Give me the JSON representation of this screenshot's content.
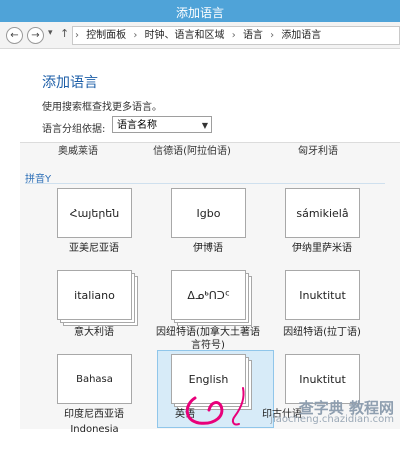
{
  "window": {
    "title": "添加语言"
  },
  "nav": {
    "back": "←",
    "forward": "→",
    "dropdown": "▾",
    "up": "↑"
  },
  "breadcrumb": [
    "控制面板",
    "时钟、语言和区域",
    "语言",
    "添加语言"
  ],
  "breadcrumb_sep": "›",
  "page": {
    "heading": "添加语言",
    "hint": "使用搜索框查找更多语言。",
    "group_label": "语言分组依据:",
    "group_value": "语言名称"
  },
  "top_row": [
    "奥威莱语",
    "信德语(阿拉伯语)",
    "匈牙利语"
  ],
  "section": "拼音Y",
  "tiles": [
    {
      "native": "Հայերեն",
      "caption": "亚美尼亚语"
    },
    {
      "native": "Igbo",
      "caption": "伊博语"
    },
    {
      "native": "sámikielâ",
      "caption": "伊纳里萨米语"
    },
    {
      "native": "italiano",
      "caption": "意大利语"
    },
    {
      "native": "ᐃᓄᒃᑎᑐᑦ",
      "caption": "因纽特语(加拿大土著语言符号)"
    },
    {
      "native": "Inuktitut",
      "caption": "因纽特语(拉丁语)"
    },
    {
      "native": "Bahasa Indonesia",
      "caption": "印度尼西亚语"
    },
    {
      "native": "English",
      "caption": "英语"
    },
    {
      "native": "Inuktitut",
      "caption": "印古什语"
    }
  ],
  "watermark": {
    "line1": "查字典 教程网",
    "line2": "jiaocheng.chazidian.com"
  },
  "colors": {
    "titlebar": "#4fa3d8",
    "accent": "#1e5fa8",
    "highlight": "#d7ebf8",
    "marker": "#e8007a"
  }
}
